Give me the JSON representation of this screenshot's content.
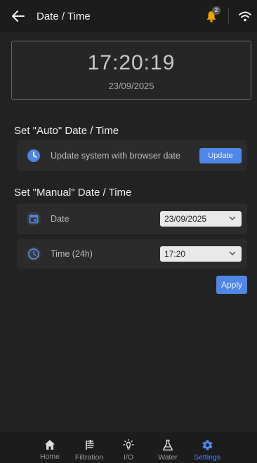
{
  "header": {
    "title": "Date / Time",
    "notification_count": "2"
  },
  "clock": {
    "time": "17:20:19",
    "date": "23/09/2025"
  },
  "auto": {
    "section_title": "Set \"Auto\" Date / Time",
    "label": "Update system with browser date",
    "button": "Update"
  },
  "manual": {
    "section_title": "Set \"Manual\" Date / Time",
    "date_label": "Date",
    "date_value": "23/09/2025",
    "time_label": "Time (24h)",
    "time_value": "17:20",
    "apply": "Apply"
  },
  "nav": {
    "items": [
      {
        "label": "Home",
        "icon": "home-icon"
      },
      {
        "label": "Filtration",
        "icon": "filtration-icon"
      },
      {
        "label": "I/O",
        "icon": "lightbulb-icon"
      },
      {
        "label": "Water",
        "icon": "flask-icon"
      },
      {
        "label": "Settings",
        "icon": "gear-icon",
        "active": true
      }
    ]
  },
  "colors": {
    "accent": "#4f86e8",
    "notification": "#f2a300",
    "background": "#222222"
  }
}
